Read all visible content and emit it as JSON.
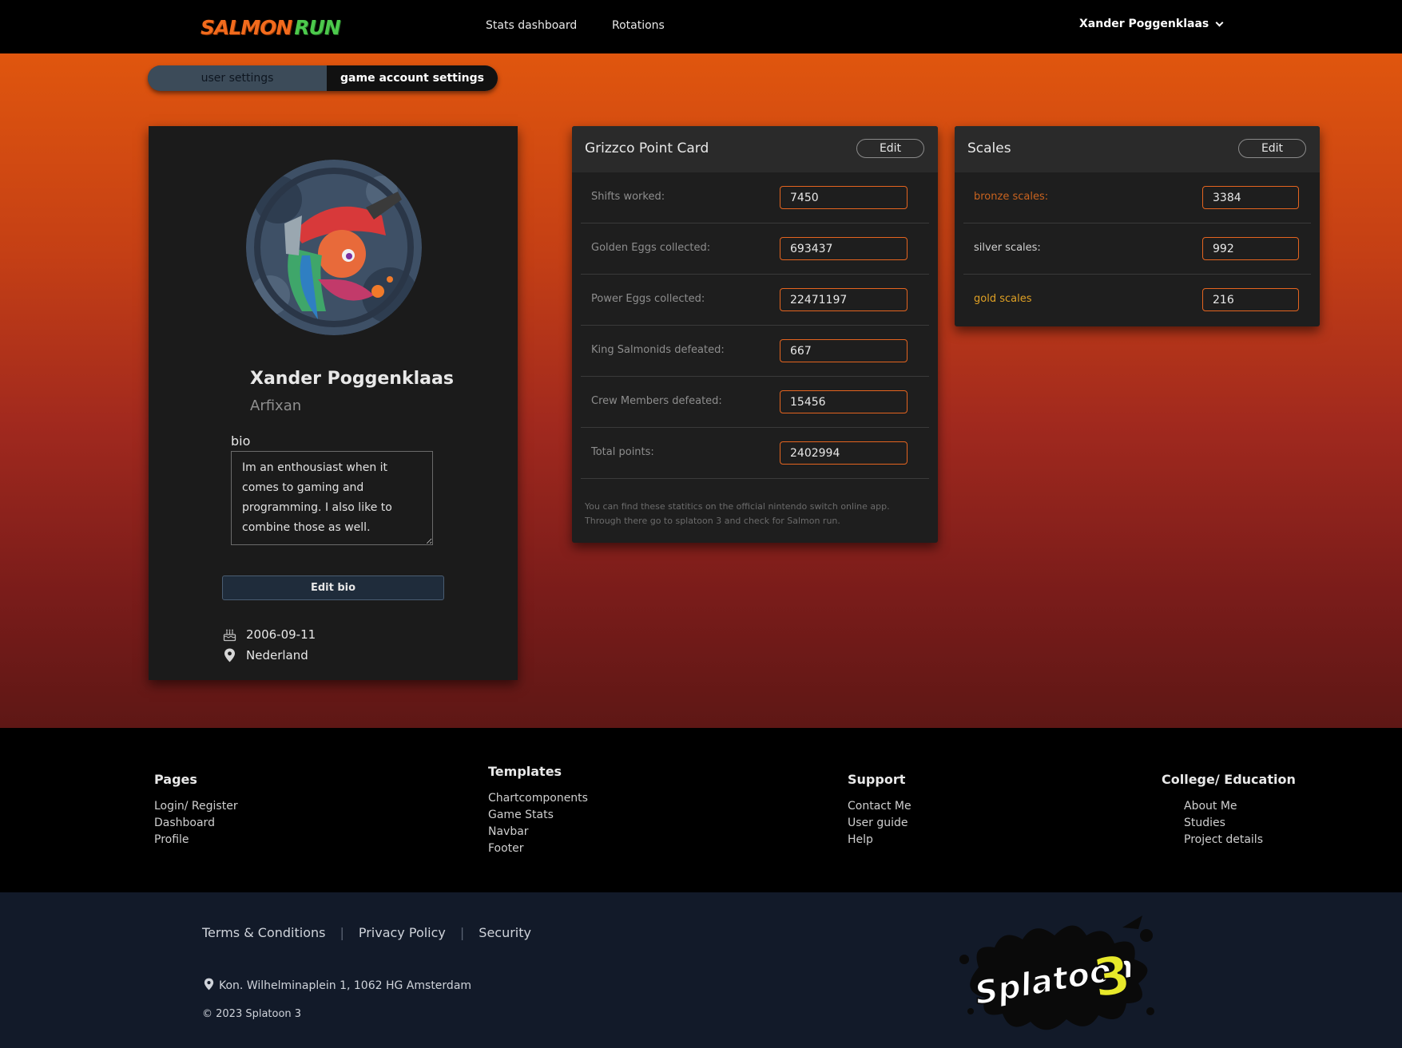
{
  "nav": {
    "logo_primary": "SALMON",
    "logo_secondary": "RUN",
    "links": [
      "Stats dashboard",
      "Rotations"
    ],
    "user_name": "Xander Poggenklaas"
  },
  "tabs": {
    "user_settings": "user settings",
    "game_account_settings": "game account settings",
    "active": "game account settings"
  },
  "profile": {
    "name": "Xander Poggenklaas",
    "handle": "Arfixan",
    "bio_label": "bio",
    "bio": "Im an enthousiast when it comes to gaming and programming. I also like to combine those as well.",
    "edit_bio_label": "Edit bio",
    "birthdate": "2006-09-11",
    "location": "Nederland"
  },
  "grizzco": {
    "title": "Grizzco Point Card",
    "edit_label": "Edit",
    "rows": [
      {
        "label": "Shifts worked:",
        "value": "7450"
      },
      {
        "label": "Golden Eggs collected:",
        "value": "693437"
      },
      {
        "label": "Power Eggs collected:",
        "value": "22471197"
      },
      {
        "label": "King Salmonids defeated:",
        "value": "667"
      },
      {
        "label": "Crew Members defeated:",
        "value": "15456"
      },
      {
        "label": "Total points:",
        "value": "2402994"
      }
    ],
    "note": "You can find these statitics on the official nintendo switch online app. Through there go to splatoon 3 and check for Salmon run."
  },
  "scales": {
    "title": "Scales",
    "edit_label": "Edit",
    "rows": [
      {
        "label": "bronze scales:",
        "value": "3384",
        "color": "#c9631f"
      },
      {
        "label": "silver scales:",
        "value": "992",
        "color": "#cfcfcf"
      },
      {
        "label": "gold scales",
        "value": "216",
        "color": "#e0a124"
      }
    ]
  },
  "footer": {
    "pages": {
      "title": "Pages",
      "links": [
        "Login/ Register",
        "Dashboard",
        "Profile"
      ]
    },
    "templates": {
      "title": "Templates",
      "links": [
        "Chartcomponents",
        "Game Stats",
        "Navbar",
        "Footer"
      ]
    },
    "support": {
      "title": "Support",
      "links": [
        "Contact Me",
        "User guide",
        "Help"
      ]
    },
    "college": {
      "title": "College/ Education",
      "links": [
        "About Me",
        "Studies",
        "Project details"
      ]
    },
    "legal": [
      "Terms & Conditions",
      "Privacy Policy",
      "Security"
    ],
    "address": "Kon. Wilhelminaplein 1, 1062 HG Amsterdam",
    "copyright": "© 2023 Splatoon 3",
    "brand_logo": "Splatoon 3"
  },
  "colors": {
    "accent_orange": "#e4641f",
    "hero_top": "#e0560e",
    "hero_bottom": "#5e1715",
    "card_bg": "#1e1e1e",
    "footer_bottom_bg": "#121a29"
  }
}
